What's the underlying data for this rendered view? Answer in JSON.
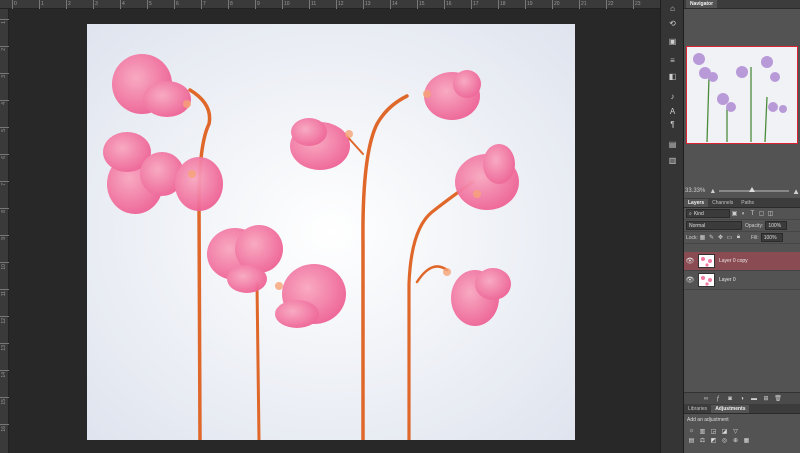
{
  "navigator": {
    "title": "Navigator",
    "zoom_value": "33.33%"
  },
  "layers": {
    "tabs": [
      {
        "label": "Layers",
        "active": true
      },
      {
        "label": "Channels",
        "active": false
      },
      {
        "label": "Paths",
        "active": false
      }
    ],
    "filter_label": "Kind",
    "blend_mode": "Normal",
    "opacity_label": "Opacity:",
    "opacity_value": "100%",
    "lock_label": "Lock:",
    "fill_label": "Fill:",
    "fill_value": "100%",
    "items": [
      {
        "name": "Layer 0 copy",
        "selected": true,
        "visible": true
      },
      {
        "name": "Layer 0",
        "selected": false,
        "visible": true
      }
    ]
  },
  "adjustments": {
    "tabs": [
      {
        "label": "Libraries",
        "active": false
      },
      {
        "label": "Adjustments",
        "active": true
      }
    ],
    "hint": "Add an adjustment"
  },
  "ruler": {
    "top_numbers": [
      "0",
      "1",
      "2",
      "3",
      "4",
      "5",
      "6",
      "7",
      "8",
      "9",
      "10",
      "11",
      "12",
      "13",
      "14",
      "15",
      "16",
      "17",
      "18",
      "19",
      "20",
      "21",
      "22",
      "23",
      "24"
    ],
    "left_numbers": [
      "1",
      "2",
      "3",
      "4",
      "5",
      "6",
      "7",
      "8",
      "9",
      "10",
      "11",
      "12",
      "13",
      "14",
      "15",
      "16",
      "17"
    ]
  },
  "colors": {
    "selected_layer": "#8a4b52",
    "petal": "#f27aa0",
    "stem": "#e0672a",
    "background": "#eef1f7"
  },
  "icons": [
    "home-icon",
    "navigator-icon",
    "history-icon",
    "adjustments-icon",
    "properties-icon",
    "glyphs-icon",
    "character-icon",
    "paragraph-icon",
    "actions-icon",
    "notes-icon"
  ]
}
